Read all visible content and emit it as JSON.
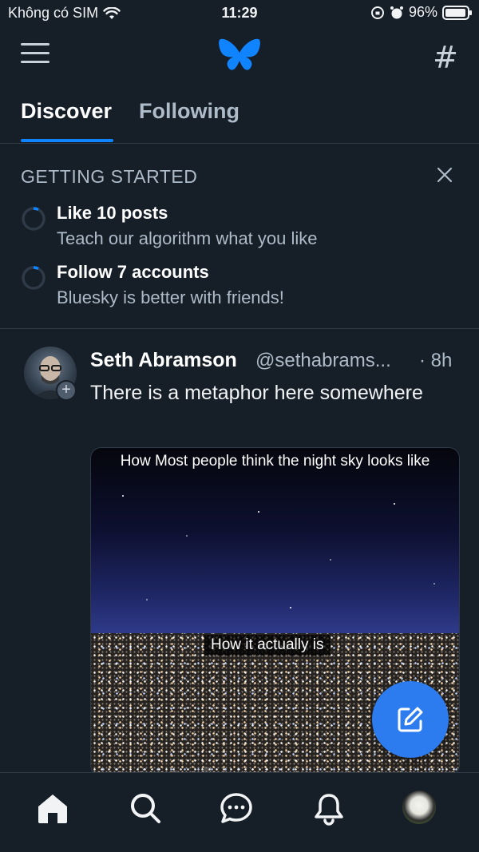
{
  "status_bar": {
    "carrier": "Không có SIM",
    "time": "11:29",
    "battery": "96%",
    "battery_level": 0.96
  },
  "header": {
    "menu_icon": "hamburger-menu-icon",
    "logo_icon": "butterfly-icon",
    "feeds_icon": "hash-icon",
    "feeds_symbol": "#"
  },
  "tabs": [
    {
      "label": "Discover",
      "active": true
    },
    {
      "label": "Following",
      "active": false
    }
  ],
  "getting_started": {
    "title": "GETTING STARTED",
    "items": [
      {
        "title": "Like 10 posts",
        "subtitle": "Teach our algorithm what you like"
      },
      {
        "title": "Follow 7 accounts",
        "subtitle": "Bluesky is better with friends!"
      }
    ]
  },
  "post": {
    "author_name": "Seth Abramson",
    "author_handle": "@sethabrams...",
    "time": "· 8h",
    "text": "There is a metaphor here somewhere",
    "image_caption_top": "How Most people think the night sky looks like",
    "image_caption_mid": "How it actually is"
  },
  "watermark": "uantrimang",
  "colors": {
    "background": "#161e27",
    "accent": "#1083fe",
    "fab": "#2c7cf0",
    "muted_text": "#aebbc9"
  },
  "bottom_nav": [
    {
      "icon": "home-icon"
    },
    {
      "icon": "search-icon"
    },
    {
      "icon": "chat-icon"
    },
    {
      "icon": "bell-icon"
    },
    {
      "icon": "profile-avatar"
    }
  ]
}
